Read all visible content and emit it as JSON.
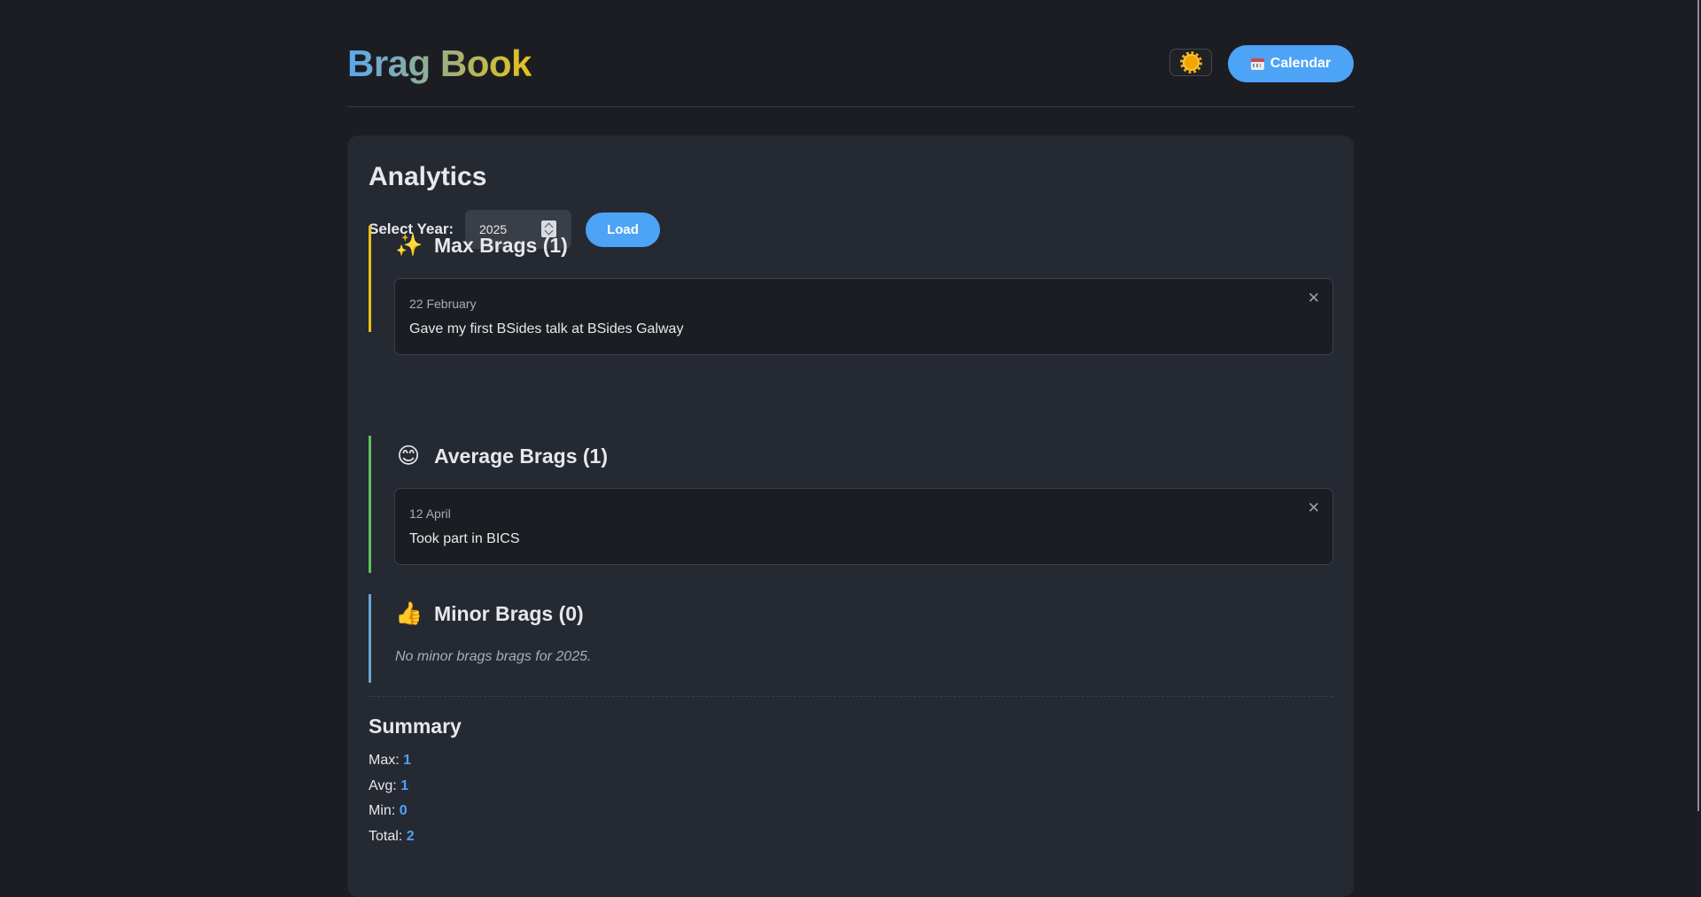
{
  "header": {
    "title": "Brag Book",
    "theme_icon": "sun-icon",
    "calendar_icon": "calendar-icon",
    "calendar_label": "Calendar"
  },
  "analytics": {
    "title": "Analytics",
    "year_label": "Select Year:",
    "year_value": "2025",
    "load_label": "Load",
    "sections": [
      {
        "emoji": "✨",
        "heading": "Max Brags (1)",
        "accent": "#e8c21a",
        "items": [
          {
            "date": "22 February",
            "text": "Gave my first BSides talk at BSides Galway",
            "close": "✕"
          }
        ]
      },
      {
        "emoji": "😊",
        "heading": "Average Brags (1)",
        "accent": "#5cc05c",
        "items": [
          {
            "date": "12 April",
            "text": "Took part in BICS",
            "close": "✕"
          }
        ]
      },
      {
        "emoji": "👍",
        "heading": "Minor Brags (0)",
        "accent": "#6aa7d8",
        "items": [],
        "empty_text": "No minor brags brags for 2025."
      }
    ]
  },
  "summary": {
    "title": "Summary",
    "max_label": "Max:",
    "max_value": "1",
    "avg_label": "Avg:",
    "avg_value": "1",
    "min_label": "Min:",
    "min_value": "0",
    "total_label": "Total:",
    "total_value": "2"
  },
  "colors": {
    "background": "#1b1d22",
    "card": "#252932",
    "accent_blue": "#4da3f5"
  }
}
